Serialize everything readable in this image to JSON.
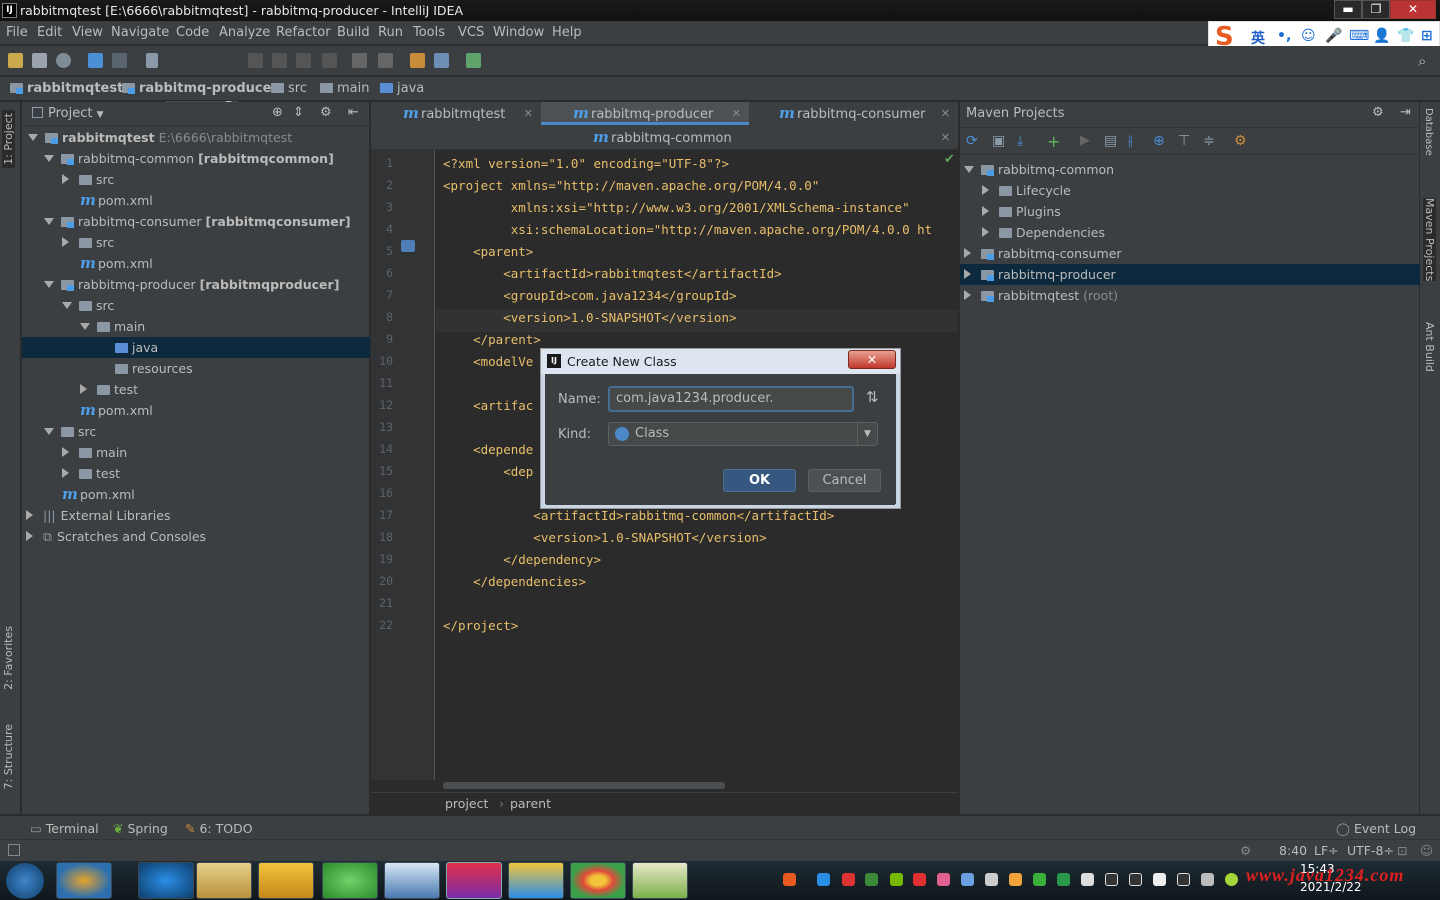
{
  "window": {
    "title": "rabbitmqtest [E:\\6666\\rabbitmqtest] - rabbitmq-producer - IntelliJ IDEA",
    "app_icon": "IJ",
    "minimize": "▬",
    "restore": "❐",
    "close": "✕"
  },
  "menu": [
    "File",
    "Edit",
    "View",
    "Navigate",
    "Code",
    "Analyze",
    "Refactor",
    "Build",
    "Run",
    "Tools",
    "VCS",
    "Window",
    "Help"
  ],
  "ime": {
    "logo": "S",
    "lang": "英"
  },
  "breadcrumb": [
    "rabbitmqtest",
    "rabbitmq-producer",
    "src",
    "main",
    "java"
  ],
  "project_panel": {
    "title": "Project",
    "tree": [
      {
        "label": "rabbitmqtest",
        "extra": "E:\\6666\\rabbitmqtest",
        "bold": true
      },
      {
        "label": "rabbitmq-common",
        "extra": "[rabbitmqcommon]"
      },
      {
        "label": "src"
      },
      {
        "label": "pom.xml"
      },
      {
        "label": "rabbitmq-consumer",
        "extra": "[rabbitmqconsumer]"
      },
      {
        "label": "src"
      },
      {
        "label": "pom.xml"
      },
      {
        "label": "rabbitmq-producer",
        "extra": "[rabbitmqproducer]"
      },
      {
        "label": "src"
      },
      {
        "label": "main"
      },
      {
        "label": "java"
      },
      {
        "label": "resources"
      },
      {
        "label": "test"
      },
      {
        "label": "pom.xml"
      },
      {
        "label": "src"
      },
      {
        "label": "main"
      },
      {
        "label": "test"
      },
      {
        "label": "pom.xml"
      },
      {
        "label": "External Libraries"
      },
      {
        "label": "Scratches and Consoles"
      }
    ]
  },
  "editor": {
    "tabs": [
      "rabbitmqtest",
      "rabbitmq-producer",
      "rabbitmq-consumer",
      "rabbitmq-common"
    ],
    "line_numbers": [
      "1",
      "2",
      "3",
      "4",
      "5",
      "6",
      "7",
      "8",
      "9",
      "10",
      "11",
      "12",
      "13",
      "14",
      "15",
      "16",
      "17",
      "18",
      "19",
      "20",
      "21",
      "22"
    ],
    "lines": [
      "<?xml version=\"1.0\" encoding=\"UTF-8\"?>",
      "<project xmlns=\"http://maven.apache.org/POM/4.0.0\"",
      "         xmlns:xsi=\"http://www.w3.org/2001/XMLSchema-instance\"",
      "         xsi:schemaLocation=\"http://maven.apache.org/POM/4.0.0 ht",
      "    <parent>",
      "        <artifactId>rabbitmqtest</artifactId>",
      "        <groupId>com.java1234</groupId>",
      "        <version>1.0-SNAPSHOT</version>",
      "    </parent>",
      "    <modelVe",
      "",
      "    <artifac",
      "",
      "    <depende",
      "        <dep",
      "",
      "            <artifactId>rabbitmq-common</artifactId>",
      "            <version>1.0-SNAPSHOT</version>",
      "        </dependency>",
      "    </dependencies>",
      "",
      "</project>"
    ],
    "breadcrumb": [
      "project",
      "parent"
    ]
  },
  "maven_panel": {
    "title": "Maven Projects",
    "tree": [
      {
        "label": "rabbitmq-common"
      },
      {
        "label": "Lifecycle"
      },
      {
        "label": "Plugins"
      },
      {
        "label": "Dependencies"
      },
      {
        "label": "rabbitmq-consumer"
      },
      {
        "label": "rabbitmq-producer"
      },
      {
        "label": "rabbitmqtest",
        "extra": "(root)"
      }
    ]
  },
  "left_stripe": [
    "1: Project",
    "2: Favorites",
    "7: Structure"
  ],
  "right_stripe": [
    "Database",
    "Maven Projects",
    "Ant Build"
  ],
  "dialog": {
    "title": "Create New Class",
    "name_label": "Name:",
    "name_value": "com.java1234.producer.",
    "kind_label": "Kind:",
    "kind_value": "Class",
    "ok": "OK",
    "cancel": "Cancel"
  },
  "bottom_tools": {
    "terminal": "Terminal",
    "spring": "Spring",
    "todo": "6: TODO",
    "event_log": "Event Log"
  },
  "status": {
    "position": "8:40",
    "line_sep": "LF÷",
    "encoding": "UTF-8÷"
  },
  "clock": {
    "time": "15:43",
    "date": "2021/2/22"
  },
  "watermark": "www.java1234.com",
  "colors": {
    "accent": "#4a88c7",
    "selection": "#0d293e",
    "tag": "#e8bf6a",
    "attr_value": "#6a8759",
    "bg": "#2b2b2b",
    "panel": "#3c3f41"
  }
}
